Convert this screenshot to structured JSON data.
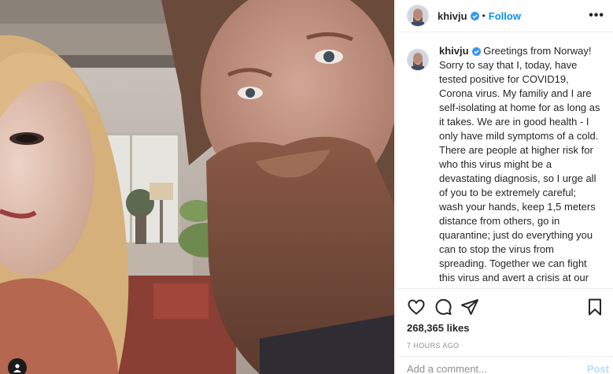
{
  "post": {
    "username": "khivju",
    "follow_label": "Follow",
    "dot": "•",
    "more_label": "•••",
    "caption_user": "khivju",
    "caption": "Greetings from Norway! Sorry to say that I, today, have tested positive for COVID19, Corona virus. My familiy and I are self-isolating at home for as long as it takes. We are in good health - I only have mild symptoms of a cold. There are people at higher risk for who this virus might be a devastating diagnosis, so I urge all of you to be extremely careful; wash your hands, keep 1,5 meters distance from others, go in quarantine; just do everything you can to stop the virus from spreading. Together we can fight this virus and avert a crisis at our hospitals. Please take care of each other, keep your distance, and stay healthy! Please visit your country's Center for Disease Control's website, and follow the",
    "likes": "268,365 likes",
    "timestamp": "7 HOURS AGO",
    "comment_placeholder": "Add a comment...",
    "post_label": "Post"
  },
  "icons": {
    "like": "heart-icon",
    "comment": "comment-icon",
    "share": "share-icon",
    "save": "bookmark-icon",
    "verified": "verified-badge-icon",
    "user_tag": "user-tag-icon"
  },
  "colors": {
    "link_blue": "#0095f6",
    "verified_blue": "#3897f0",
    "muted": "#8e8e8e",
    "post_disabled": "#b2dffc"
  }
}
